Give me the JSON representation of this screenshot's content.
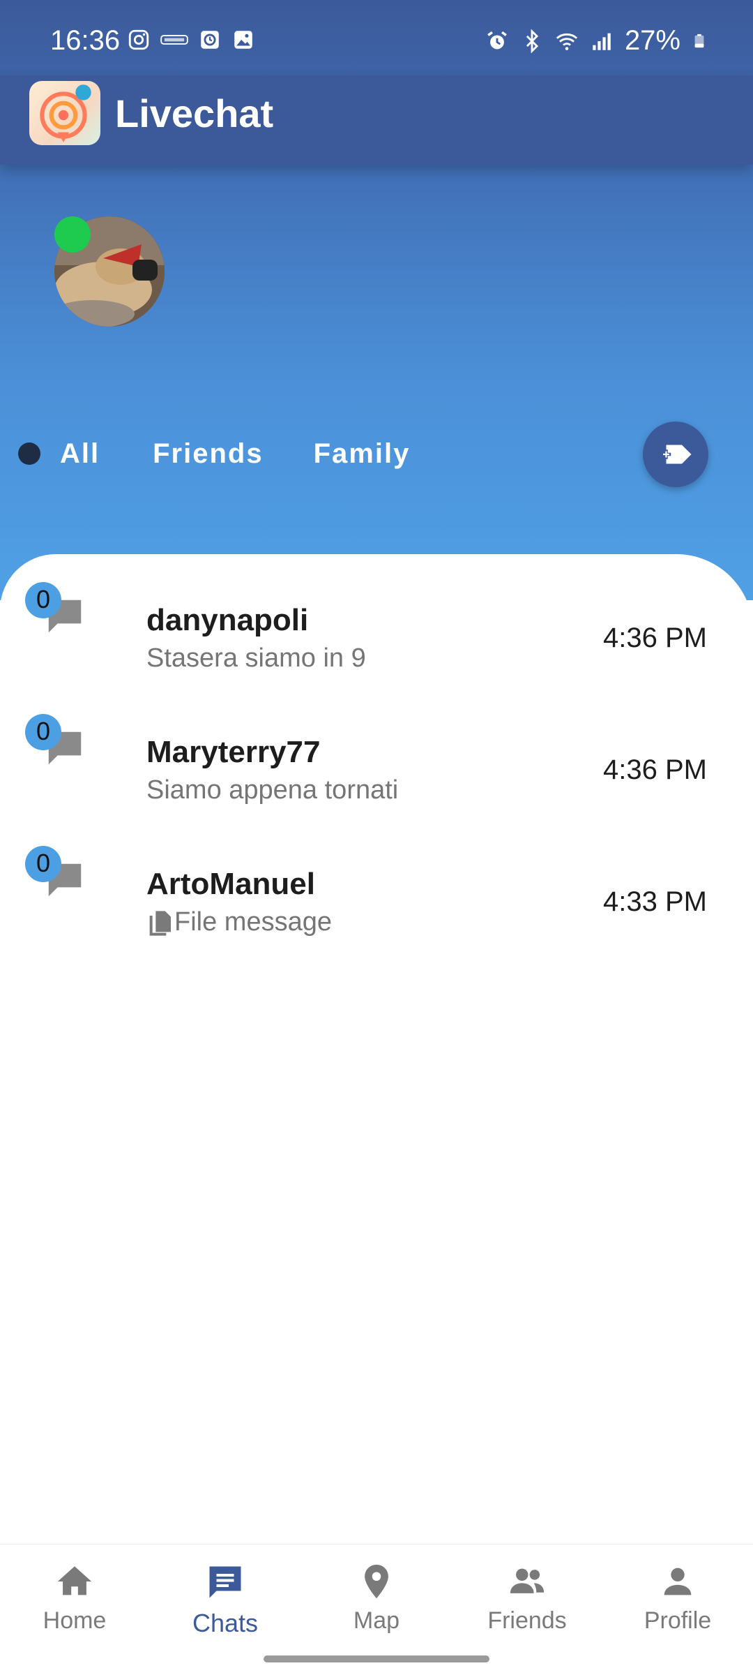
{
  "status_bar": {
    "time": "16:36",
    "battery": "27%",
    "left_icons": [
      "instagram-icon",
      "osm-icon",
      "clock-app-icon",
      "gallery-icon"
    ],
    "right_icons": [
      "alarm-icon",
      "bluetooth-icon",
      "wifi-icon",
      "signal-icon",
      "battery-icon"
    ]
  },
  "app_bar": {
    "title": "Livechat"
  },
  "filters": [
    {
      "label": "All",
      "selected": true
    },
    {
      "label": "Friends",
      "selected": false
    },
    {
      "label": "Family",
      "selected": false
    }
  ],
  "chats": [
    {
      "name": "danynapoli",
      "preview": "Stasera siamo in 9",
      "time": "4:36 PM",
      "unread": "0",
      "preview_icon": ""
    },
    {
      "name": "Maryterry77",
      "preview": "Siamo appena tornati",
      "time": "4:36 PM",
      "unread": "0",
      "preview_icon": ""
    },
    {
      "name": "ArtoManuel",
      "preview": "File message",
      "time": "4:33 PM",
      "unread": "0",
      "preview_icon": "file-icon"
    }
  ],
  "bottom_nav": [
    {
      "label": "Home",
      "icon": "home-icon",
      "active": false
    },
    {
      "label": "Chats",
      "icon": "chat-icon",
      "active": true
    },
    {
      "label": "Map",
      "icon": "map-pin-icon",
      "active": false
    },
    {
      "label": "Friends",
      "icon": "friends-icon",
      "active": false
    },
    {
      "label": "Profile",
      "icon": "profile-icon",
      "active": false
    }
  ],
  "colors": {
    "primary": "#3c5a9a",
    "gradient_bottom": "#50a0e5",
    "online": "#1ecb4f",
    "badge": "#4d9fe3",
    "inactive": "#7a7a7a"
  }
}
